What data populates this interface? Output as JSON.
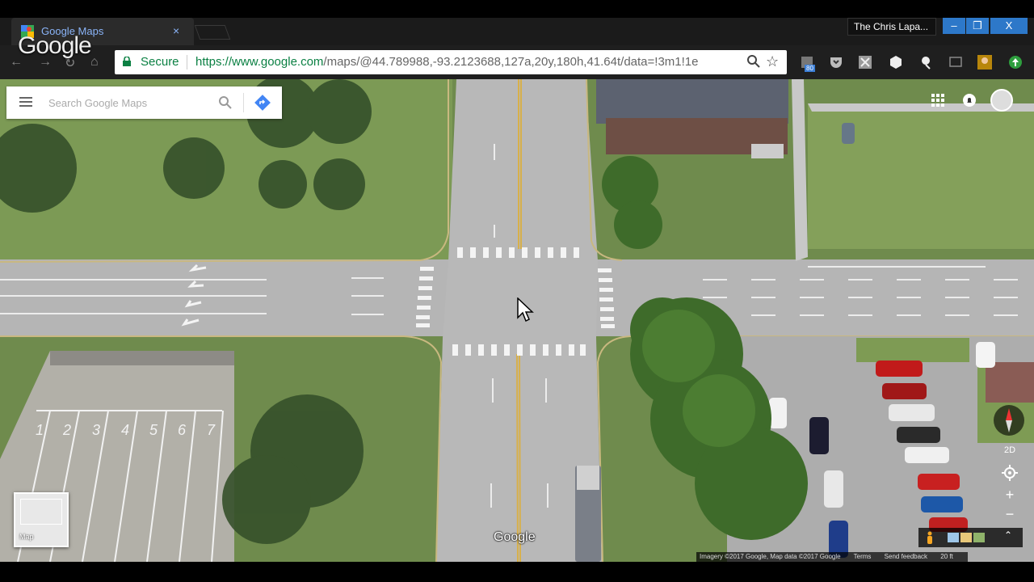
{
  "browser": {
    "tab_title": "Google Maps",
    "tab_close": "×",
    "profile_name": "The Chris Lapa...",
    "window_minimize": "–",
    "window_restore": "❐",
    "window_close": "X",
    "overlay_logo": "Google",
    "security_label": "Secure",
    "url_scheme": "https://",
    "url_host": "www.google.com",
    "url_path": "/maps/@44.789988,-93.2123688,127a,20y,180h,41.64t/data=!3m1!1e",
    "extension_badge": "80",
    "star_icon": "☆"
  },
  "maps": {
    "search_placeholder": "Search Google Maps",
    "view_toggle": "2D",
    "zoom_in": "+",
    "zoom_out": "−",
    "expand_icon": "⌃",
    "map_type_label": "Map",
    "logo": "Google",
    "attribution": {
      "imagery": "Imagery ©2017 Google, Map data ©2017 Google",
      "terms": "Terms",
      "feedback": "Send feedback",
      "scale": "20 ft"
    },
    "track_lane_numbers": [
      "1",
      "2",
      "3",
      "4",
      "5",
      "6",
      "7"
    ]
  }
}
